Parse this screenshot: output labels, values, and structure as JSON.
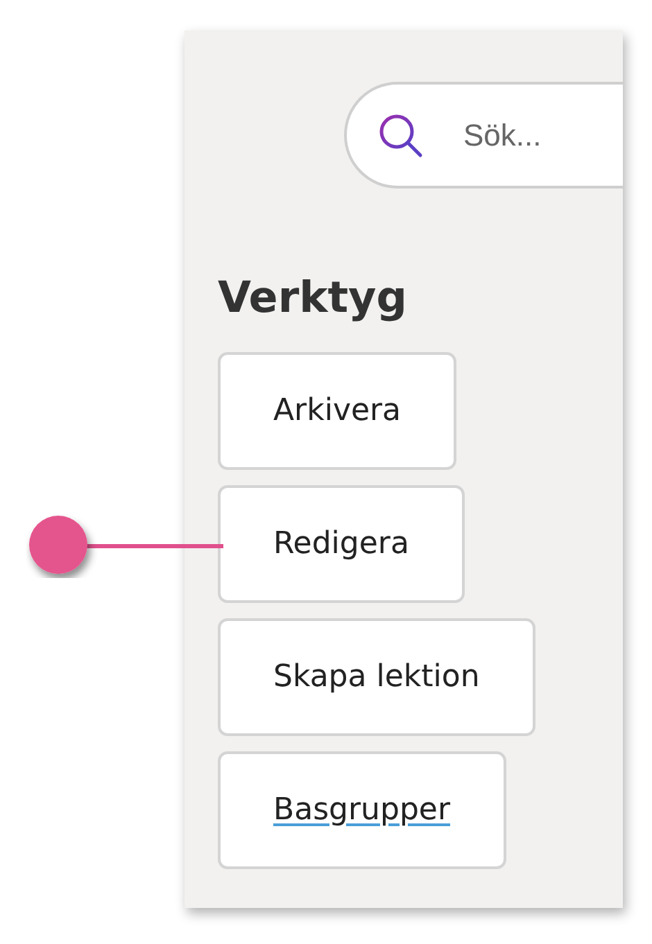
{
  "search": {
    "placeholder": "Sök..."
  },
  "tools": {
    "title": "Verktyg",
    "items": [
      {
        "label": "Arkivera",
        "marked": false,
        "underlined": false
      },
      {
        "label": "Redigera",
        "marked": true,
        "underlined": false
      },
      {
        "label": "Skapa lektion",
        "marked": false,
        "underlined": false
      },
      {
        "label": "Basgrupper",
        "marked": false,
        "underlined": true
      }
    ]
  }
}
